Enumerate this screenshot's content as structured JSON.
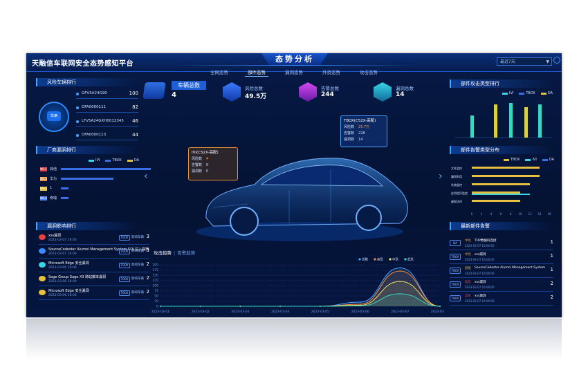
{
  "header": {
    "brand": "天融信车联网安全态势感知平台",
    "center_title": "态势分析",
    "select_value": "最近7天",
    "tabs": [
      "全网态势",
      "部件态势",
      "漏洞态势",
      "外资态势",
      "攻击态势"
    ]
  },
  "kpis": {
    "vehicle_total_label": "车辆总数",
    "vehicle_total_value": "4",
    "risk_label": "风险总数",
    "risk_value": "49.5万",
    "alert_label": "告警总数",
    "alert_value": "244",
    "vuln_label": "漏洞总数",
    "vuln_value": "14"
  },
  "risk_ranking": {
    "title": "风险车辆排行",
    "center_label": "车辆",
    "items": [
      {
        "name": "GFV5A24G90",
        "value": "100"
      },
      {
        "name": "DFA0000111",
        "value": "82"
      },
      {
        "name": "LFV5A24GXH0012345",
        "value": "46"
      },
      {
        "name": "DFA0000113",
        "value": "44"
      }
    ]
  },
  "vendor_vuln": {
    "title": "厂商漏洞排行",
    "legend": [
      "IVI",
      "TBOX",
      "DA"
    ],
    "rows": [
      {
        "badge": "NO.1",
        "category": "其他",
        "value": 12
      },
      {
        "badge": "NO.2",
        "category": "华为",
        "value": 7
      },
      {
        "badge": "NO.3",
        "category": "1",
        "value": 1
      },
      {
        "badge": "NO.4",
        "category": "奇瑞",
        "value": 1
      }
    ]
  },
  "vuln_impact": {
    "title": "漏洞影响排行",
    "rows": [
      {
        "title": "xss漏洞",
        "date": "2023-03-07 16:00",
        "tag": "TBOX",
        "text": "影响车辆",
        "count": "3"
      },
      {
        "title": "SourceCodester Alumni Management System SQL注入漏洞",
        "date": "2023-03-07 16:00",
        "tag": "TBOX",
        "text": "影响车辆",
        "count": "3"
      },
      {
        "title": "Microsoft Edge 安全漏洞",
        "date": "2023-03-06 16:00",
        "tag": "TBOX",
        "text": "影响车辆",
        "count": "2"
      },
      {
        "title": "Sage Group Sage X3 跨站脚本漏洞",
        "date": "2023-03-06 16:00",
        "tag": "TBOX",
        "text": "影响车辆",
        "count": "2"
      },
      {
        "title": "Microsoft Edge 安全漏洞",
        "date": "2023-03-06 16:00",
        "tag": "TBOX",
        "text": "影响车辆",
        "count": "2"
      }
    ]
  },
  "callout_ivi": {
    "title": "IVI(C52X-高配)",
    "rows": [
      {
        "label": "风险数",
        "value": "4"
      },
      {
        "label": "告警数",
        "value": "0"
      },
      {
        "label": "漏洞数",
        "value": "0"
      }
    ]
  },
  "callout_tbox": {
    "title": "TBOX(C52X-高配)",
    "rows": [
      {
        "label": "风险数",
        "value": "25.7万"
      },
      {
        "label": "告警数",
        "value": "228"
      },
      {
        "label": "漏洞数",
        "value": "14"
      }
    ]
  },
  "component_attack": {
    "title": "部件攻击类型排行",
    "legend": [
      "IVI",
      "TBOX",
      "DA"
    ]
  },
  "component_alert": {
    "title": "部件告警类型分布",
    "legend": [
      "TBOX",
      "IVI",
      "DA"
    ],
    "categories": [
      "文件监控",
      "漏洞利用",
      "系统监控",
      "应用程序监控",
      "越权访问"
    ],
    "x_ticks": [
      "0",
      "2",
      "4",
      "6",
      "8",
      "10",
      "12",
      "14",
      "16"
    ]
  },
  "latest_alerts": {
    "title": "最新部件告警",
    "rows": [
      {
        "tag": "DA",
        "level": "中危",
        "title": "TOP数据码连接",
        "date": "2023-03-07 16:00:00",
        "count": "1"
      },
      {
        "tag": "TBOX",
        "level": "中危",
        "title": "xss漏洞",
        "date": "2023-03-07 16:00:00",
        "count": "1"
      },
      {
        "tag": "TBOX",
        "level": "低危",
        "title": "SourceCodester Alumni Management System",
        "date": "2023-03-07 16:00:00",
        "count": "1"
      },
      {
        "tag": "TBOX",
        "level": "高危",
        "title": "xss漏洞",
        "date": "2023-03-07 16:00:00",
        "count": "2"
      },
      {
        "tag": "TBOX",
        "level": "高危",
        "title": "xss漏洞",
        "date": "2023-03-07 16:00:00",
        "count": "2"
      }
    ]
  },
  "trend": {
    "tab_active": "攻击趋势",
    "tab_alt": "告警趋势"
  },
  "chart_data": {
    "type": "area",
    "title": "",
    "x": [
      "2023-03-01",
      "2023-03-02",
      "2023-03-03",
      "2023-03-04",
      "2023-03-05",
      "2023-03-06",
      "2023-03-07",
      "2023-03-08"
    ],
    "ylim": [
      0,
      200
    ],
    "y_ticks": [
      "0",
      "25",
      "50",
      "75",
      "100",
      "125",
      "150",
      "175",
      "200"
    ],
    "legend_placement": "top-right",
    "series": [
      {
        "name": "总数",
        "color": "#4aa3ff",
        "values": [
          0,
          0,
          0,
          0,
          0,
          20,
          185,
          0
        ]
      },
      {
        "name": "高危",
        "color": "#ff8a3a",
        "values": [
          0,
          0,
          0,
          0,
          0,
          10,
          170,
          0
        ]
      },
      {
        "name": "中危",
        "color": "#f0e060",
        "values": [
          0,
          0,
          0,
          0,
          0,
          5,
          120,
          0
        ]
      },
      {
        "name": "低危",
        "color": "#38d6c4",
        "values": [
          0,
          0,
          0,
          0,
          0,
          2,
          60,
          0
        ]
      }
    ]
  }
}
